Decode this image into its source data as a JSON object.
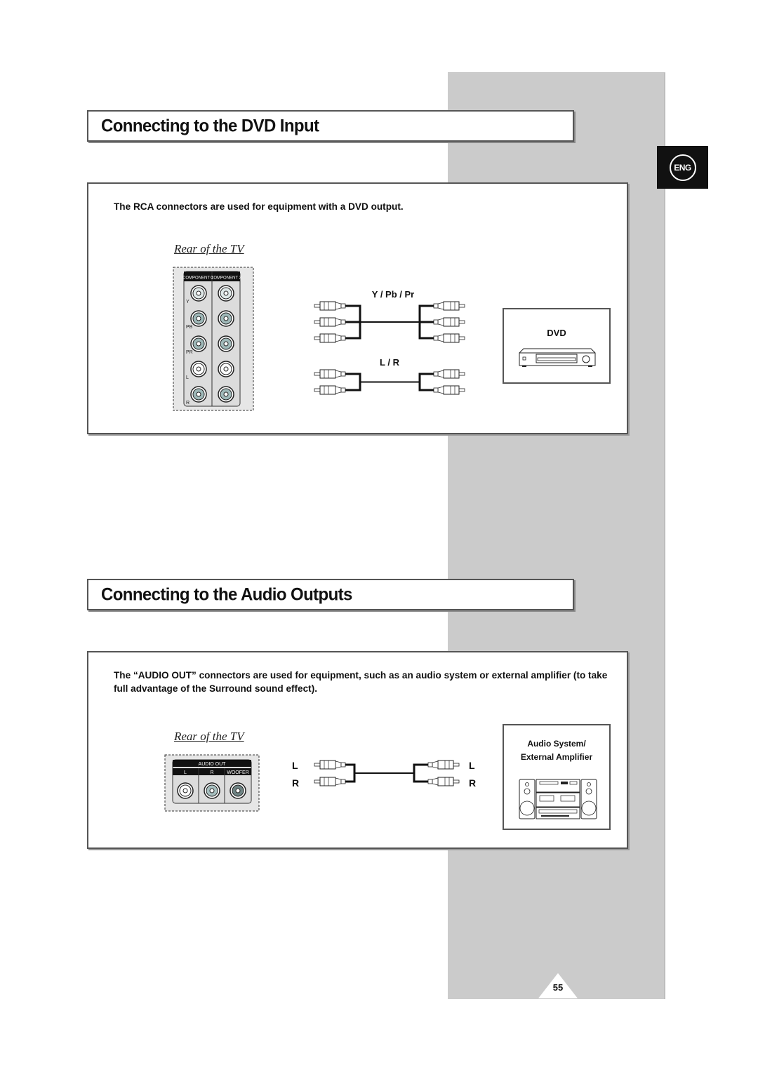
{
  "language_tab": {
    "label": "ENG"
  },
  "sections": [
    {
      "title": "Connecting to the DVD Input",
      "description": "The RCA connectors are used for equipment with a DVD output.",
      "rear_label": "Rear of the TV",
      "panel": {
        "headers": [
          "COMPONENT 1",
          "COMPONENT 2"
        ],
        "row_labels": [
          "Y",
          "PB",
          "PR",
          "L",
          "R"
        ]
      },
      "cables": [
        {
          "label": "Y / Pb / Pr",
          "plugs": 3
        },
        {
          "label": "L / R",
          "plugs": 2
        }
      ],
      "device": {
        "label": "DVD",
        "icon": "dvd-player-icon"
      }
    },
    {
      "title": "Connecting to the Audio Outputs",
      "description": "The “AUDIO OUT” connectors are used for equipment, such as an audio system or external amplifier (to take full advantage of the Surround sound effect).",
      "rear_label": "Rear of the TV",
      "panel": {
        "header": "AUDIO OUT",
        "jacks": [
          "L",
          "R",
          "WOOFER"
        ]
      },
      "cable": {
        "left_labels": [
          "L",
          "R"
        ],
        "right_labels": [
          "L",
          "R"
        ]
      },
      "device": {
        "label_line1": "Audio System/",
        "label_line2": "External Amplifier",
        "icon": "stereo-system-icon"
      }
    }
  ],
  "page_number": "55"
}
